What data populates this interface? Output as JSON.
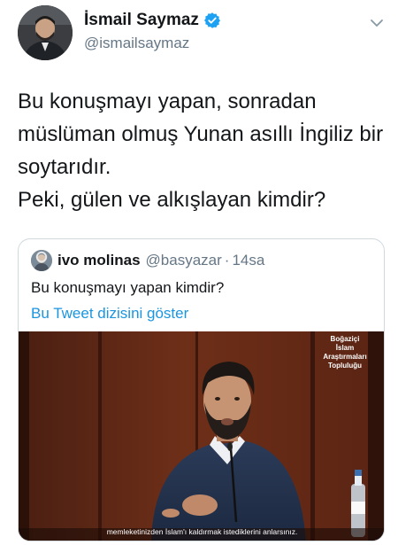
{
  "author": {
    "display_name": "İsmail Saymaz",
    "handle": "@ismailsaymaz",
    "verified_icon": "verified-badge-icon",
    "menu_icon": "chevron-down-icon"
  },
  "tweet": {
    "lines": [
      "Bu konuşmayı yapan, sonradan",
      "müslüman olmuş Yunan asıllı İngiliz bir",
      "soytarıdır.",
      "Peki, gülen ve alkışlayan kimdir?"
    ]
  },
  "quoted": {
    "display_name": "ivo molinas",
    "handle": "@basyazar",
    "separator": "·",
    "time": "14sa",
    "text": "Bu konuşmayı yapan kimdir?",
    "thread_link": "Bu Tweet dizisini göster",
    "media": {
      "overlay_lines": [
        "Boğaziçi",
        "İslam",
        "Araştırmaları Topluluğu"
      ],
      "subtitle": "memleketinizden İslam'ı kaldırmak istediklerini anlarsınız."
    }
  },
  "colors": {
    "text": "#14171a",
    "secondary": "#657786",
    "link": "#1b95e0",
    "verified": "#1da1f2",
    "border": "#cfd9de"
  }
}
